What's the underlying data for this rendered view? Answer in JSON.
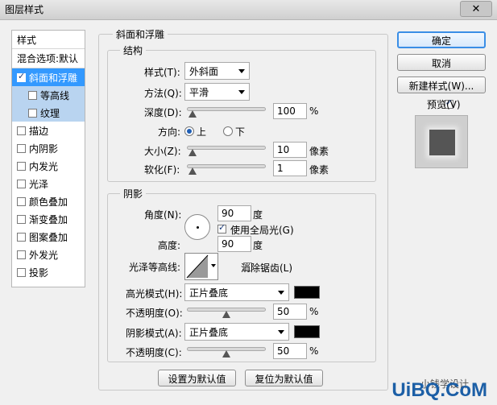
{
  "window": {
    "title": "图层样式",
    "close_label": "✕"
  },
  "styles_list": {
    "header": "样式",
    "blend_options": "混合选项:默认",
    "items": [
      {
        "label": "斜面和浮雕",
        "checked": true
      },
      {
        "label": "等高线",
        "checked": false
      },
      {
        "label": "纹理",
        "checked": false
      },
      {
        "label": "描边",
        "checked": false
      },
      {
        "label": "内阴影",
        "checked": false
      },
      {
        "label": "内发光",
        "checked": false
      },
      {
        "label": "光泽",
        "checked": false
      },
      {
        "label": "颜色叠加",
        "checked": false
      },
      {
        "label": "渐变叠加",
        "checked": false
      },
      {
        "label": "图案叠加",
        "checked": false
      },
      {
        "label": "外发光",
        "checked": false
      },
      {
        "label": "投影",
        "checked": false
      }
    ]
  },
  "bevel": {
    "section_title": "斜面和浮雕",
    "structure_title": "结构",
    "style_label": "样式(T):",
    "style_value": "外斜面",
    "technique_label": "方法(Q):",
    "technique_value": "平滑",
    "depth_label": "深度(D):",
    "depth_value": "100",
    "depth_unit": "%",
    "direction_label": "方向:",
    "direction_up": "上",
    "direction_down": "下",
    "size_label": "大小(Z):",
    "size_value": "10",
    "size_unit": "像素",
    "soften_label": "软化(F):",
    "soften_value": "1",
    "soften_unit": "像素"
  },
  "shading": {
    "title": "阴影",
    "angle_label": "角度(N):",
    "angle_value": "90",
    "angle_unit": "度",
    "global_light_label": "使用全局光(G)",
    "altitude_label": "高度:",
    "altitude_value": "90",
    "altitude_unit": "度",
    "gloss_contour_label": "光泽等高线:",
    "anti_aliased_label": "消除锯齿(L)",
    "highlight_mode_label": "高光模式(H):",
    "highlight_mode_value": "正片叠底",
    "highlight_opacity_label": "不透明度(O):",
    "highlight_opacity_value": "50",
    "shadow_mode_label": "阴影模式(A):",
    "shadow_mode_value": "正片叠底",
    "shadow_opacity_label": "不透明度(C):",
    "shadow_opacity_value": "50",
    "opacity_unit": "%",
    "highlight_color": "#000000",
    "shadow_color": "#000000"
  },
  "bottom_buttons": {
    "make_default": "设置为默认值",
    "reset_default": "复位为默认值"
  },
  "right_panel": {
    "ok": "确定",
    "cancel": "取消",
    "new_style": "新建样式(W)...",
    "preview_label": "预览(V)"
  },
  "watermark": {
    "wechat": "小钱学设计",
    "site": "UiBQ.CoM"
  },
  "colors": {
    "accent": "#3399ff",
    "sub_selected": "#b9d4f0"
  }
}
